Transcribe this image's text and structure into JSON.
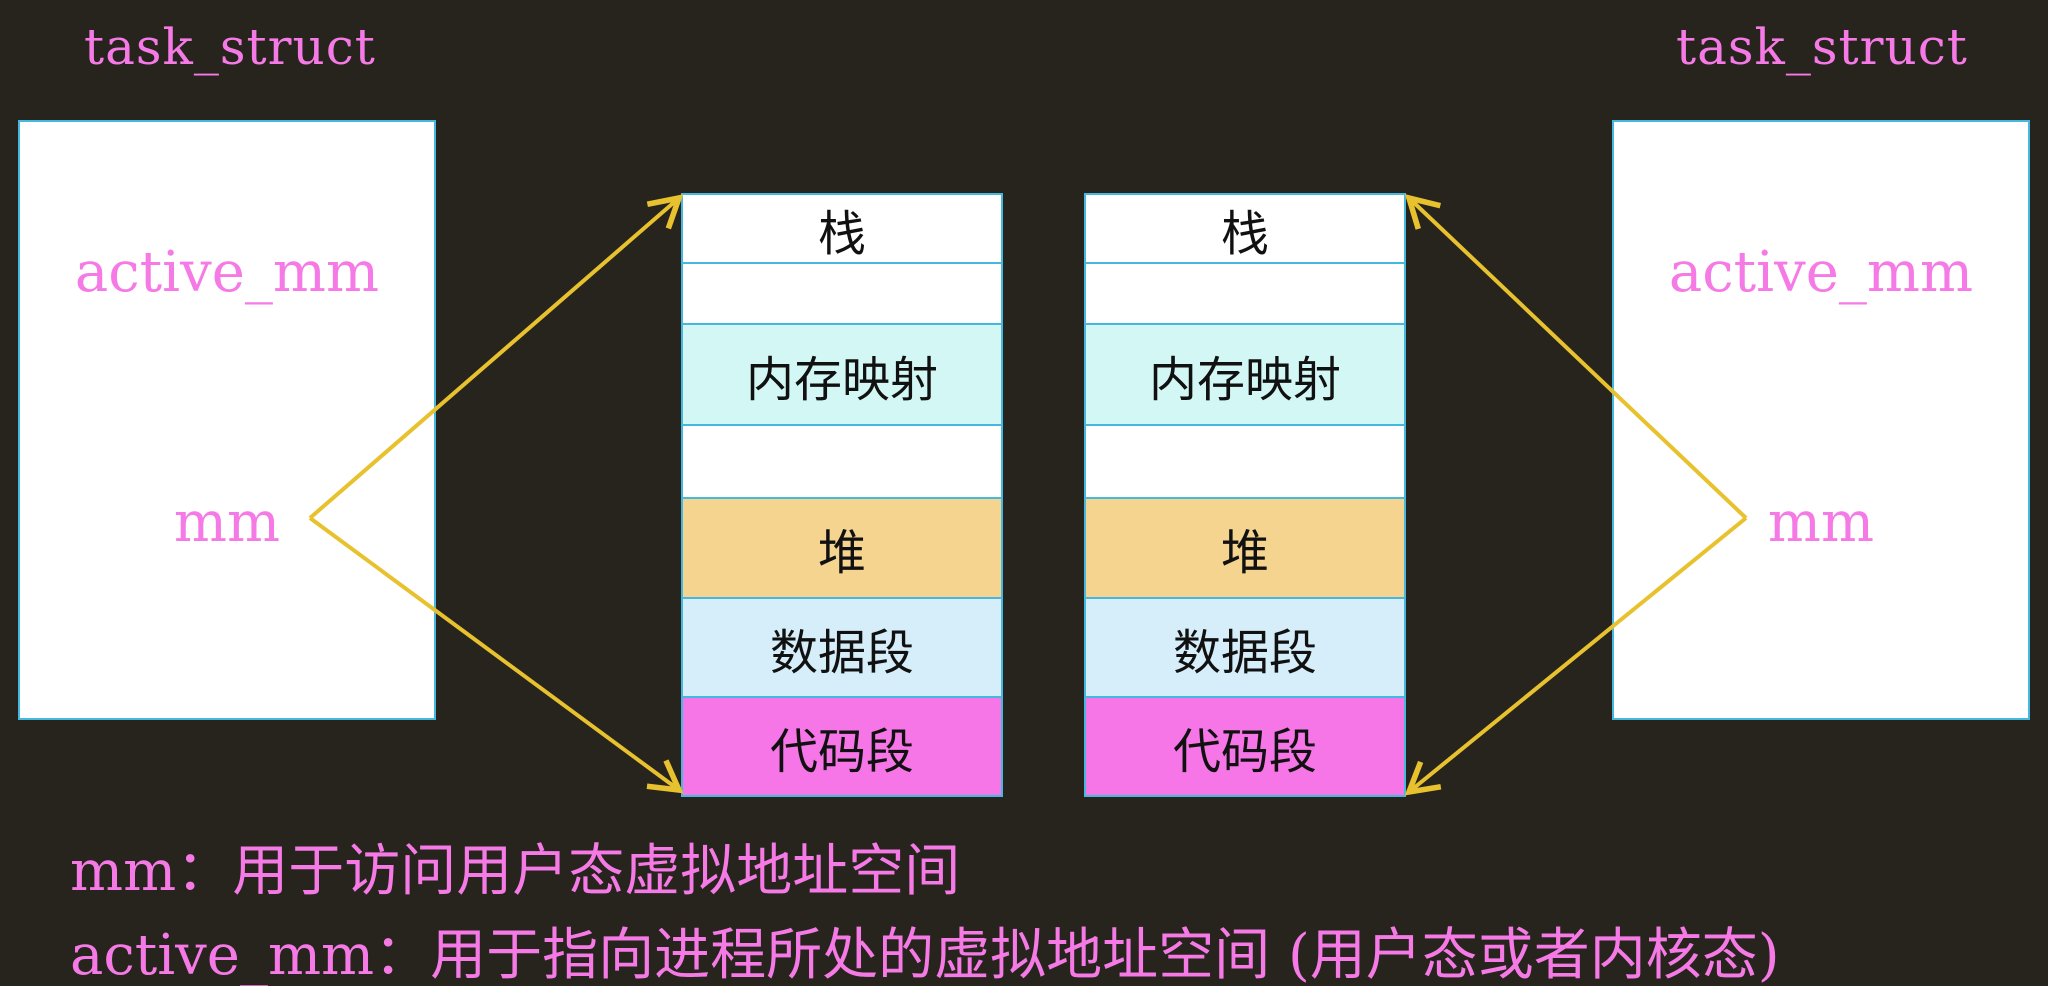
{
  "left_task": {
    "title": "task_struct",
    "field_active": "active_mm",
    "field_mm": "mm"
  },
  "right_task": {
    "title": "task_struct",
    "field_active": "active_mm",
    "field_mm": "mm"
  },
  "left_memory": {
    "segments": [
      {
        "label": "栈",
        "color": "#ffffff"
      },
      {
        "label": "",
        "color": "#ffffff"
      },
      {
        "label": "内存映射",
        "color": "#d2f7f5"
      },
      {
        "label": "",
        "color": "#ffffff"
      },
      {
        "label": "堆",
        "color": "#f4d48e"
      },
      {
        "label": "数据段",
        "color": "#d5eef9"
      },
      {
        "label": "代码段",
        "color": "#f776e7"
      }
    ]
  },
  "right_memory": {
    "segments": [
      {
        "label": "栈",
        "color": "#ffffff"
      },
      {
        "label": "",
        "color": "#ffffff"
      },
      {
        "label": "内存映射",
        "color": "#d2f7f5"
      },
      {
        "label": "",
        "color": "#ffffff"
      },
      {
        "label": "堆",
        "color": "#f4d48e"
      },
      {
        "label": "数据段",
        "color": "#d5eef9"
      },
      {
        "label": "代码段",
        "color": "#f776e7"
      }
    ]
  },
  "captions": {
    "line1": "mm：用于访问用户态虚拟地址空间",
    "line2": "active_mm：用于指向进程所处的虚拟地址空间 (用户态或者内核态)"
  },
  "colors": {
    "background": "#27231d",
    "accent_text": "#f57ae6",
    "arrow": "#e8c22e",
    "border": "#45b8e0"
  }
}
